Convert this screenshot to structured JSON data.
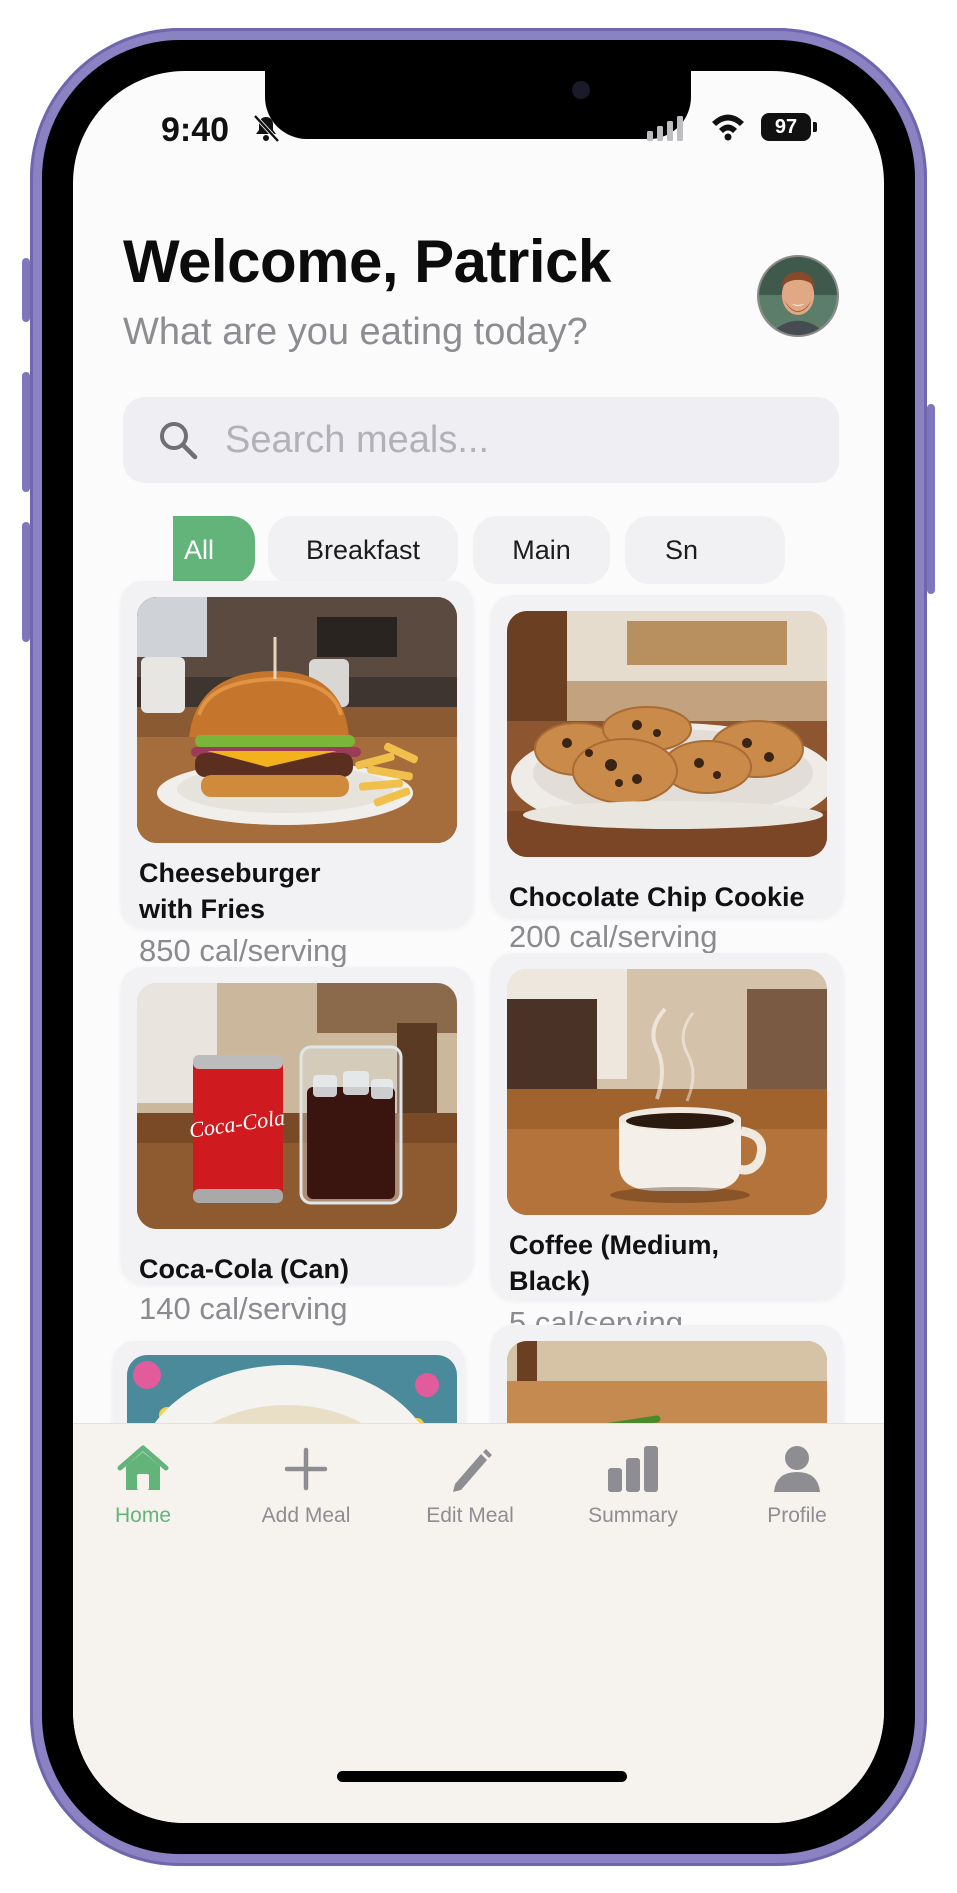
{
  "status_bar": {
    "time": "9:40",
    "battery": "97"
  },
  "header": {
    "title": "Welcome, Patrick",
    "subtitle": "What are you eating today?"
  },
  "search": {
    "placeholder": "Search meals...",
    "value": ""
  },
  "filters": [
    "All",
    "Breakfast",
    "Main",
    "Sn"
  ],
  "meals": [
    {
      "name_lines": [
        "Cheeseburger",
        "with Fries"
      ],
      "calories": "850 cal/serving"
    },
    {
      "name_lines": [
        "Chocolate Chip Cookie"
      ],
      "calories": "200 cal/serving"
    },
    {
      "name_lines": [
        "Coca-Cola (Can)"
      ],
      "calories": "140 cal/serving"
    },
    {
      "name_lines": [
        "Coffee (Medium,",
        "Black)"
      ],
      "calories": "5 cal/serving"
    }
  ],
  "can_text": "Coca-Cola",
  "tabbar": {
    "items": [
      {
        "label": "Home",
        "icon": "home-icon",
        "active": true
      },
      {
        "label": "Add Meal",
        "icon": "plus-icon",
        "active": false
      },
      {
        "label": "Edit Meal",
        "icon": "pencil-icon",
        "active": false
      },
      {
        "label": "Summary",
        "icon": "bar-chart-icon",
        "active": false
      },
      {
        "label": "Profile",
        "icon": "person-icon",
        "active": false
      }
    ]
  },
  "colors": {
    "accent": "#63b47a",
    "frame": "#8b82c4",
    "tab_inactive": "#8d8d92"
  }
}
